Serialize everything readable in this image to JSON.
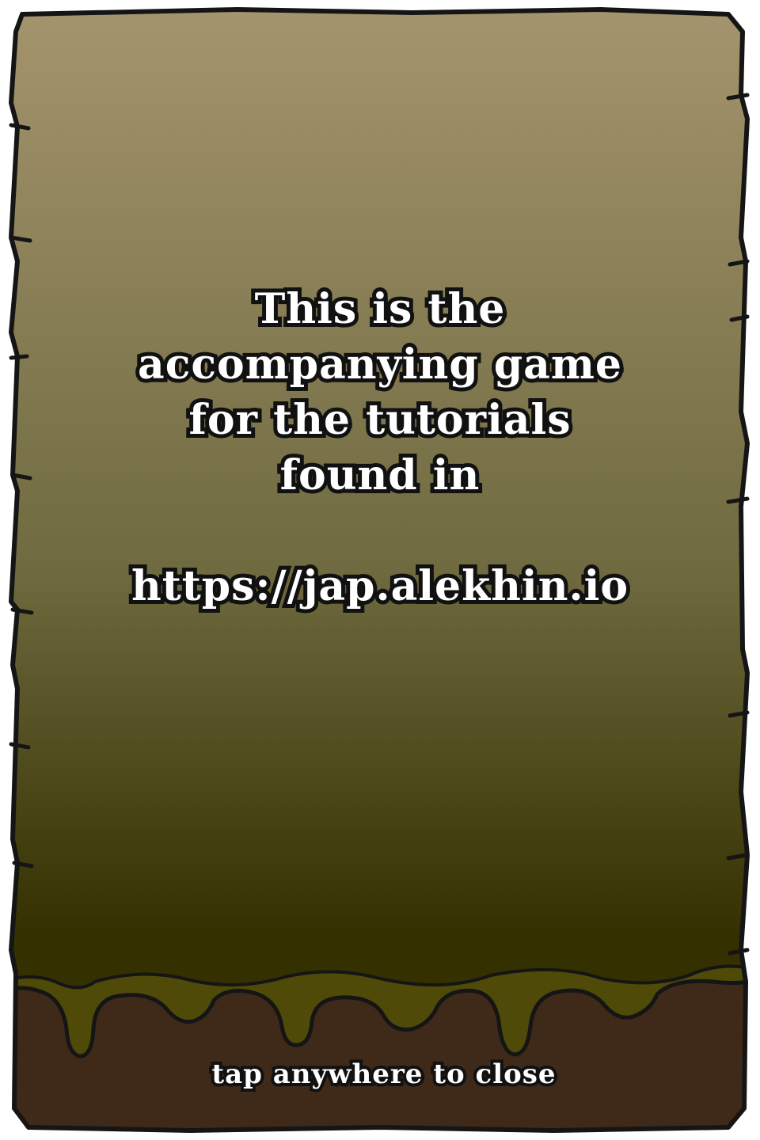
{
  "info_panel": {
    "lines": [
      "This is the",
      "accompanying game",
      "for the tutorials",
      "found in"
    ],
    "url": "https://jap.alekhin.io"
  },
  "close_hint": "tap anywhere to close",
  "colors": {
    "panel_top": "#a5956f",
    "panel_bottom": "#343000",
    "outline": "#151515",
    "slime_highlight": "#4f4a08",
    "mud": "#3f2a19",
    "text": "#ffffff",
    "text_outline": "#111111"
  }
}
